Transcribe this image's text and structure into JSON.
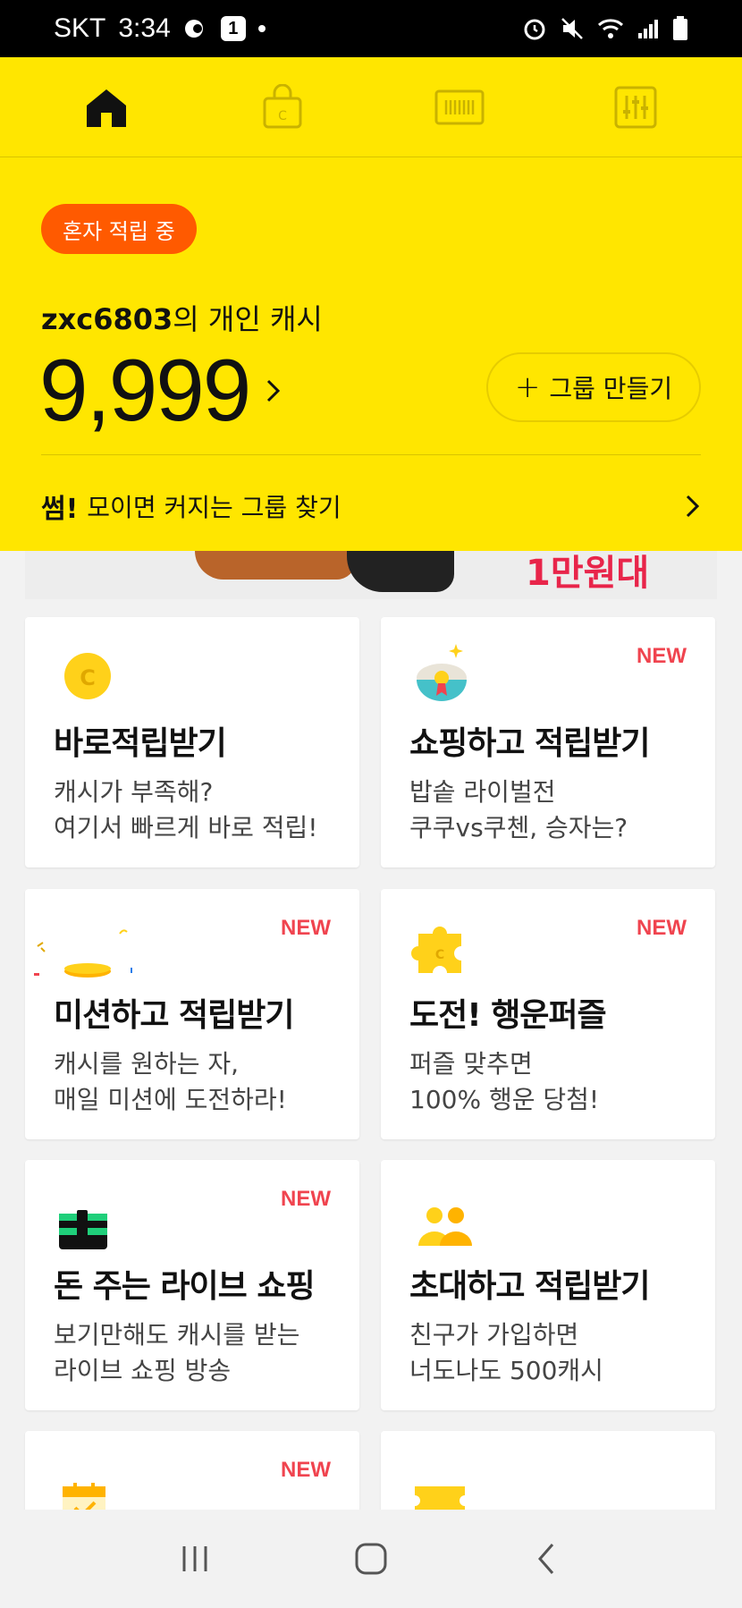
{
  "status_bar": {
    "carrier": "SKT",
    "time": "3:34",
    "notification_count": "1"
  },
  "nav": {
    "items": [
      "home",
      "shop",
      "barcode",
      "settings"
    ]
  },
  "header": {
    "badge": "혼자 적립 중",
    "username": "zxc6803",
    "cash_label_suffix": "의 개인 캐시",
    "cash_amount": "9,999",
    "group_button": "그룹 만들기",
    "group_button_icon": "+",
    "find_group_bold": "썸!",
    "find_group_text": "모이면 커지는 그룹 찾기"
  },
  "banner": {
    "text": "1만원대"
  },
  "cards": [
    {
      "title": "바로적립받기",
      "desc1": "캐시가 부족해?",
      "desc2": "여기서 빠르게 바로 적립!",
      "new": ""
    },
    {
      "title": "쇼핑하고 적립받기",
      "desc1": "밥솥 라이벌전",
      "desc2": "쿠쿠vs쿠첸, 승자는?",
      "new": "NEW"
    },
    {
      "title": "미션하고 적립받기",
      "desc1": "캐시를 원하는 자,",
      "desc2": "매일 미션에 도전하라!",
      "new": "NEW"
    },
    {
      "title": "도전! 행운퍼즐",
      "desc1": "퍼즐 맞추면",
      "desc2": "100% 행운 당첨!",
      "new": "NEW"
    },
    {
      "title": "돈 주는 라이브 쇼핑",
      "desc1": "보기만해도 캐시를 받는",
      "desc2": "라이브 쇼핑 방송",
      "new": "NEW"
    },
    {
      "title": "초대하고 적립받기",
      "desc1": "친구가 가입하면",
      "desc2": "너도나도 500캐시",
      "new": ""
    },
    {
      "title": "",
      "desc1": "",
      "desc2": "",
      "new": "NEW"
    },
    {
      "title": "",
      "desc1": "",
      "desc2": "",
      "new": ""
    }
  ],
  "colors": {
    "header_bg": "#ffe600",
    "badge_bg": "#ff5a00",
    "new_label": "#f0444f",
    "coin": "#ffd11a"
  }
}
